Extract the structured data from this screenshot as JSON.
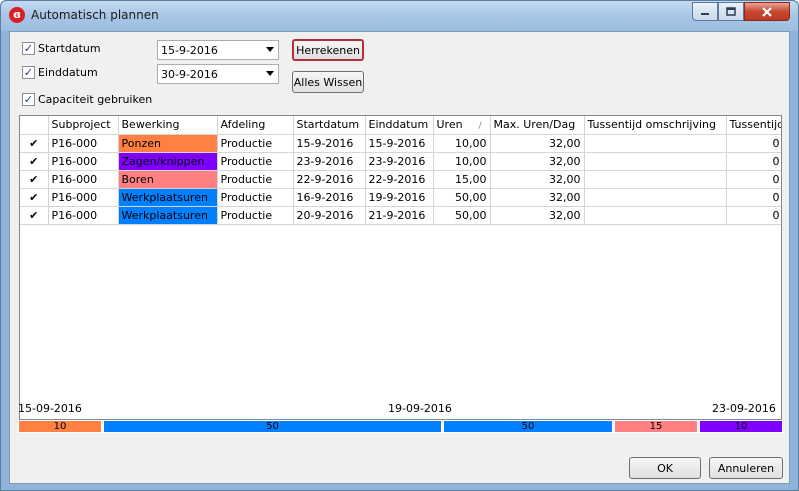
{
  "window": {
    "title": "Automatisch plannen"
  },
  "filters": {
    "startdatum": {
      "label": "Startdatum",
      "checked": "✓",
      "value": "15-9-2016"
    },
    "einddatum": {
      "label": "Einddatum",
      "checked": "✓",
      "value": "30-9-2016"
    },
    "capaciteit": {
      "label": "Capaciteit gebruiken",
      "checked": "✓"
    }
  },
  "buttons": {
    "herrekenen": "Herrekenen",
    "alles_wissen": "Alles Wissen",
    "ok": "OK",
    "annuleren": "Annuleren"
  },
  "grid": {
    "columns": [
      "",
      "Subproject",
      "Bewerking",
      "Afdeling",
      "Startdatum",
      "Einddatum",
      "Uren",
      "Max. Uren/Dag",
      "Tussentijd omschrijving",
      "Tussentijd"
    ],
    "sort_indicator": "/",
    "rows": [
      {
        "checked": "✔",
        "subproject": "P16-000",
        "bewerking": "Ponzen",
        "color": "#ff8040",
        "afdeling": "Productie",
        "start": "15-9-2016",
        "eind": "15-9-2016",
        "uren": "10,00",
        "max": "32,00",
        "omschrijving": "",
        "tussentijd": "0"
      },
      {
        "checked": "✔",
        "subproject": "P16-000",
        "bewerking": "Zagen/knippen",
        "color": "#8000ff",
        "afdeling": "Productie",
        "start": "23-9-2016",
        "eind": "23-9-2016",
        "uren": "10,00",
        "max": "32,00",
        "omschrijving": "",
        "tussentijd": "0"
      },
      {
        "checked": "✔",
        "subproject": "P16-000",
        "bewerking": "Boren",
        "color": "#ff8080",
        "afdeling": "Productie",
        "start": "22-9-2016",
        "eind": "22-9-2016",
        "uren": "15,00",
        "max": "32,00",
        "omschrijving": "",
        "tussentijd": "0"
      },
      {
        "checked": "✔",
        "subproject": "P16-000",
        "bewerking": "Werkplaatsuren",
        "color": "#0080ff",
        "afdeling": "Productie",
        "start": "16-9-2016",
        "eind": "19-9-2016",
        "uren": "50,00",
        "max": "32,00",
        "omschrijving": "",
        "tussentijd": "0"
      },
      {
        "checked": "✔",
        "subproject": "P16-000",
        "bewerking": "Werkplaatsuren",
        "color": "#0080ff",
        "afdeling": "Productie",
        "start": "20-9-2016",
        "eind": "21-9-2016",
        "uren": "50,00",
        "max": "32,00",
        "omschrijving": "",
        "tussentijd": "0"
      }
    ]
  },
  "timeline": {
    "start_label": "15-09-2016",
    "mid_label": "19-09-2016",
    "end_label": "23-09-2016",
    "segments": [
      {
        "value": "10",
        "color": "#ff8040"
      },
      {
        "value": "50",
        "color": "#0080ff"
      },
      {
        "value": "50",
        "color": "#0080ff"
      },
      {
        "value": "15",
        "color": "#ff8080"
      },
      {
        "value": "10",
        "color": "#8000ff"
      }
    ]
  }
}
